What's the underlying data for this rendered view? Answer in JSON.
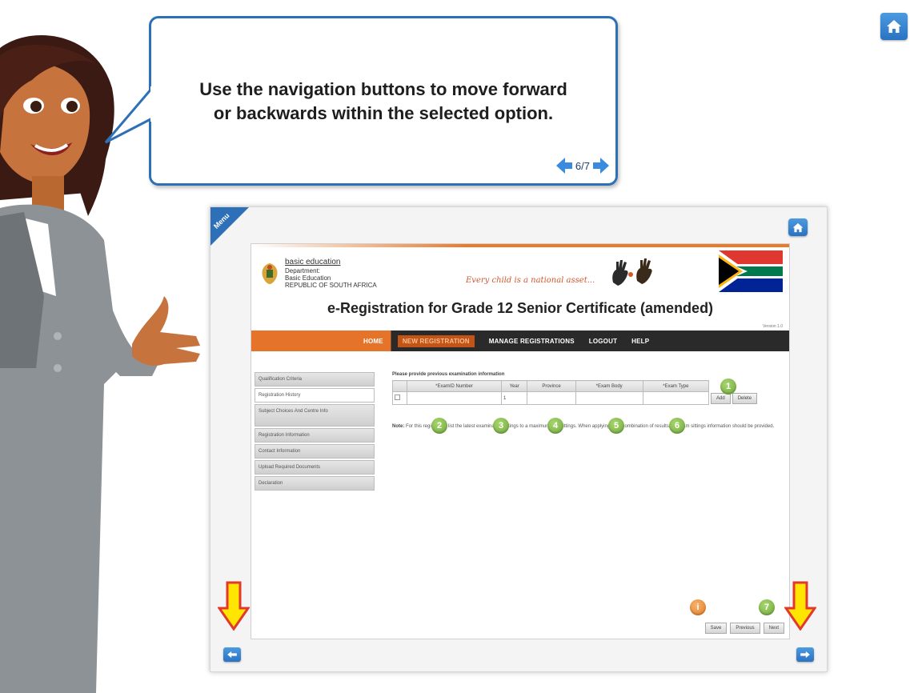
{
  "bubble": {
    "line1": "Use the navigation buttons to move forward",
    "line2": "or backwards within the selected option.",
    "counter": "6/7"
  },
  "frame": {
    "menu_label": "Menu"
  },
  "site": {
    "logo_title": "basic education",
    "logo_line1": "Department:",
    "logo_line2": "Basic Education",
    "logo_line3": "REPUBLIC OF SOUTH AFRICA",
    "slogan": "Every child is a national asset...",
    "title": "e-Registration for Grade 12 Senior Certificate (amended)",
    "version": "Version 1.0"
  },
  "nav": {
    "items": [
      "HOME",
      "NEW REGISTRATION",
      "MANAGE REGISTRATIONS",
      "LOGOUT",
      "HELP"
    ]
  },
  "sidebar": {
    "items": [
      "Qualification Criteria",
      "Registration History",
      "Subject Choices And Centre Info",
      "Registration Information",
      "Contact Information",
      "Upload Required Documents",
      "Declaration"
    ]
  },
  "content": {
    "prompt": "Please provide previous examination information",
    "columns": [
      "*ExamID Number",
      "Year",
      "Province",
      "*Exam Body",
      "*Exam Type"
    ],
    "row_year": "1",
    "add_label": "Add",
    "delete_label": "Delete",
    "note_label": "Note:",
    "note_text": "For this registration list the latest examination sittings to a maximum of 6 sittings. When applying for a combination of results, all exam sittings information should be provided."
  },
  "badges": {
    "b1": "1",
    "b2": "2",
    "b3": "3",
    "b4": "4",
    "b5": "5",
    "b6": "6",
    "b7": "7",
    "bi": "i"
  },
  "bottom": {
    "save": "Save",
    "previous": "Previous",
    "next": "Next"
  },
  "colors": {
    "accent_blue": "#2d70b8",
    "nav_orange": "#e6732a",
    "badge_green": "#6ea83b",
    "badge_orange": "#e37c25",
    "arrow_yellow": "#ffe500"
  },
  "icons": [
    "home-icon",
    "arrow-left-icon",
    "arrow-right-icon",
    "down-arrow-icon"
  ]
}
